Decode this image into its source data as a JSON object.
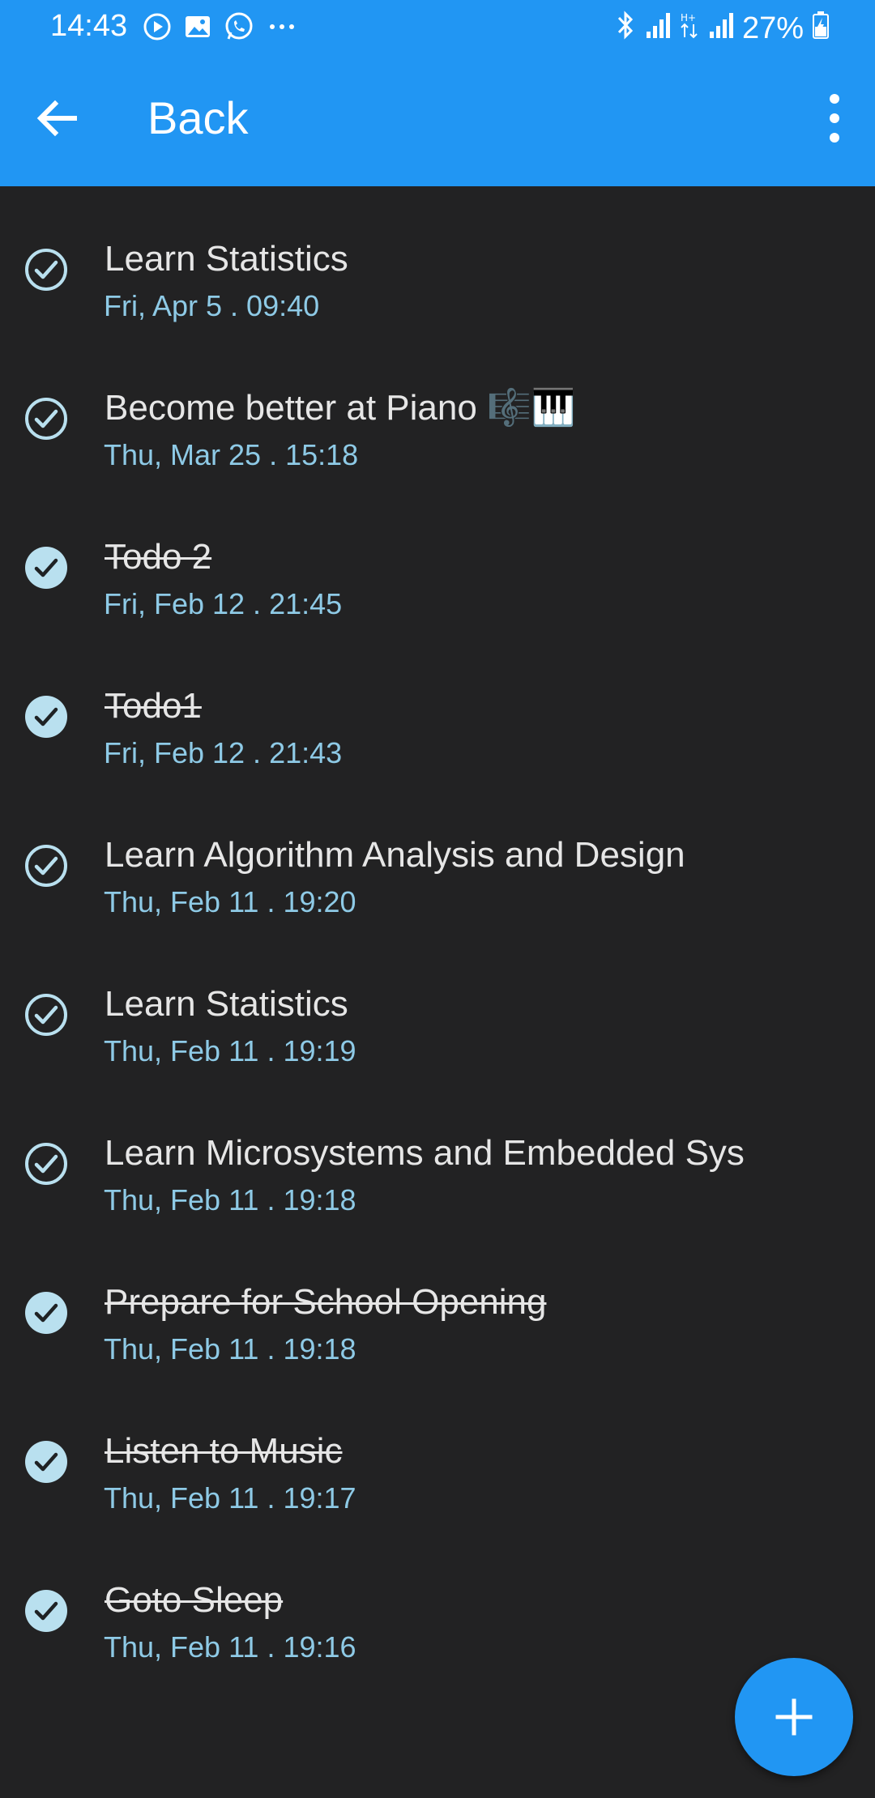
{
  "status_bar": {
    "time": "14:43",
    "left_icons": [
      "play-icon",
      "gallery-icon",
      "whatsapp-icon",
      "more-notifications-icon"
    ],
    "right_icons": [
      "bluetooth-icon",
      "signal-icon",
      "data-transfer-icon",
      "signal-icon",
      "battery-charging-icon"
    ],
    "battery": "27%"
  },
  "toolbar": {
    "title": "Back",
    "back_icon": "arrow-left-icon",
    "menu_icon": "more-vert-icon",
    "color": "#2196f3"
  },
  "todos": [
    {
      "title": "Learn Statistics",
      "date": "Fri, Apr 5 . 09:40",
      "completed": false
    },
    {
      "title": "Become better at Piano 🎼🎹",
      "date": "Thu, Mar 25 . 15:18",
      "completed": false
    },
    {
      "title": "Todo 2",
      "date": "Fri, Feb 12 . 21:45",
      "completed": true
    },
    {
      "title": "Todo1",
      "date": "Fri, Feb 12 . 21:43",
      "completed": true
    },
    {
      "title": "Learn Algorithm Analysis and Design",
      "date": "Thu, Feb 11 . 19:20",
      "completed": false
    },
    {
      "title": "Learn Statistics",
      "date": "Thu, Feb 11 . 19:19",
      "completed": false
    },
    {
      "title": "Learn Microsystems and Embedded Sys",
      "date": "Thu, Feb 11 . 19:18",
      "completed": false
    },
    {
      "title": "Prepare for School Opening",
      "date": "Thu, Feb 11 . 19:18",
      "completed": true
    },
    {
      "title": "Listen to Music",
      "date": "Thu, Feb 11 . 19:17",
      "completed": true
    },
    {
      "title": "Goto Sleep",
      "date": "Thu, Feb 11 . 19:16",
      "completed": true
    }
  ],
  "fab": {
    "icon": "plus-icon",
    "color": "#2196f3"
  },
  "colors": {
    "background": "#222223",
    "title_text": "#e6e6e6",
    "date_text": "#8ecae6",
    "check_done_fill": "#b9e0ef"
  }
}
